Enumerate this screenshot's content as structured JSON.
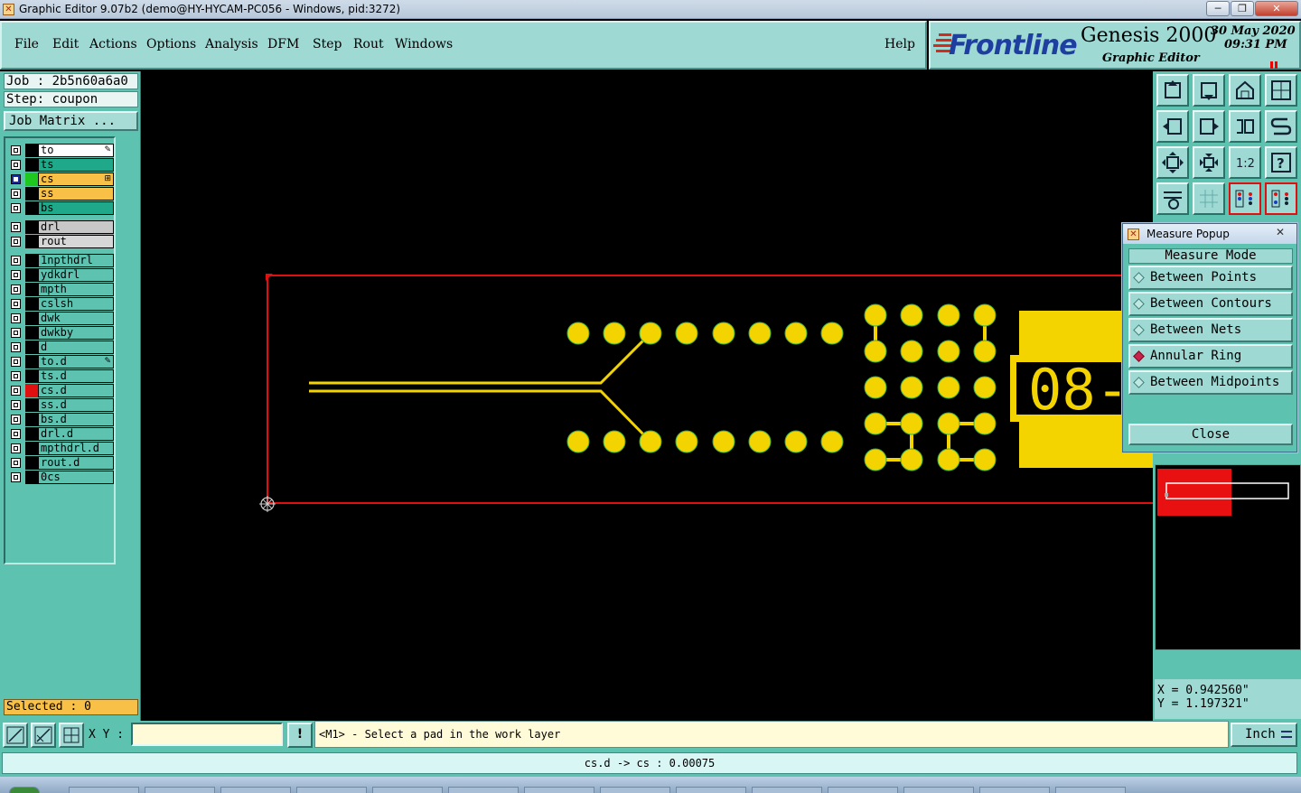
{
  "window": {
    "title": "Graphic Editor 9.07b2 (demo@HY-HYCAM-PC056 - Windows, pid:3272)",
    "minimize_label": "─",
    "maximize_label": "❐",
    "close_label": "✕"
  },
  "menu": {
    "items": [
      {
        "label": "File"
      },
      {
        "label": "Edit"
      },
      {
        "label": "Actions"
      },
      {
        "label": "Options"
      },
      {
        "label": "Analysis"
      },
      {
        "label": "DFM"
      },
      {
        "label": "Step"
      },
      {
        "label": "Rout"
      },
      {
        "label": "Windows"
      }
    ],
    "help": "Help"
  },
  "branding": {
    "logo": "Frontline",
    "product": "Genesis 2000",
    "subtitle": "Graphic Editor",
    "date": "30 May 2020",
    "time": "09:31 PM"
  },
  "job": {
    "job_label": "Job : 2b5n60a6a0",
    "step_label": "Step: coupon",
    "matrix_button": "Job Matrix ..."
  },
  "layers": [
    {
      "name": "to",
      "bg": "#ffffff",
      "color": "#000000",
      "mark": "✎"
    },
    {
      "name": "ts",
      "bg": "#1fa98a",
      "color": "#000000"
    },
    {
      "name": "cs",
      "bg": "#f8c046",
      "color": "#1ec81e",
      "mark": "⊞",
      "work": true
    },
    {
      "name": "ss",
      "bg": "#f8c046",
      "color": "#000000"
    },
    {
      "name": "bs",
      "bg": "#1fa98a",
      "color": "#000000"
    },
    {
      "name": "drl",
      "bg": "#c8c8c8",
      "color": "#000000"
    },
    {
      "name": "rout",
      "bg": "#d7d7d7",
      "color": "#000000"
    },
    {
      "name": "1npthdrl",
      "bg": "#5dc2b0",
      "color": "#000000"
    },
    {
      "name": "ydkdrl",
      "bg": "#5dc2b0",
      "color": "#000000"
    },
    {
      "name": "mpth",
      "bg": "#5dc2b0",
      "color": "#000000"
    },
    {
      "name": "cslsh",
      "bg": "#5dc2b0",
      "color": "#000000"
    },
    {
      "name": "dwk",
      "bg": "#5dc2b0",
      "color": "#000000"
    },
    {
      "name": "dwkby",
      "bg": "#5dc2b0",
      "color": "#000000"
    },
    {
      "name": "d",
      "bg": "#5dc2b0",
      "color": "#000000"
    },
    {
      "name": "to.d",
      "bg": "#5dc2b0",
      "color": "#000000",
      "mark": "✎"
    },
    {
      "name": "ts.d",
      "bg": "#5dc2b0",
      "color": "#000000"
    },
    {
      "name": "cs.d",
      "bg": "#5dc2b0",
      "color": "#e01010"
    },
    {
      "name": "ss.d",
      "bg": "#5dc2b0",
      "color": "#000000"
    },
    {
      "name": "bs.d",
      "bg": "#5dc2b0",
      "color": "#000000"
    },
    {
      "name": "drl.d",
      "bg": "#5dc2b0",
      "color": "#000000"
    },
    {
      "name": "mpthdrl.d",
      "bg": "#5dc2b0",
      "color": "#000000"
    },
    {
      "name": "rout.d",
      "bg": "#5dc2b0",
      "color": "#000000"
    },
    {
      "name": "0cs",
      "bg": "#5dc2b0",
      "color": "#000000"
    }
  ],
  "selected": "Selected : 0",
  "canvas": {
    "board_text": "08-"
  },
  "measure_popup": {
    "title": "Measure Popup",
    "heading": "Measure Mode",
    "options": [
      {
        "label": "Between Points",
        "selected": false
      },
      {
        "label": "Between Contours",
        "selected": false
      },
      {
        "label": "Between Nets",
        "selected": false
      },
      {
        "label": "Annular Ring",
        "selected": true
      },
      {
        "label": "Between Midpoints",
        "selected": false
      }
    ],
    "close_label": "Close",
    "close_x": "✕"
  },
  "toolbar_icons": [
    "zoom-home-icon",
    "zoom-fit-icon",
    "home-icon",
    "window-icon",
    "pan-left-icon",
    "pan-right-icon",
    "undo-view-icon",
    "redraw-icon",
    "zoom-in-icon",
    "zoom-out-icon",
    "one-to-one-icon",
    "help-icon",
    "tools-icon",
    "grid-icon",
    "layers-display-icon",
    "layers-compare-icon"
  ],
  "coordinates": {
    "x": "X = 0.942560\"",
    "y": "Y = 1.197321\""
  },
  "bottom": {
    "xy_label": "X Y :",
    "xy_value": "",
    "bang": "!",
    "prompt": "<M1> - Select a pad in the work layer",
    "unit": "Inch"
  },
  "status": "cs.d -> cs : 0.00075"
}
